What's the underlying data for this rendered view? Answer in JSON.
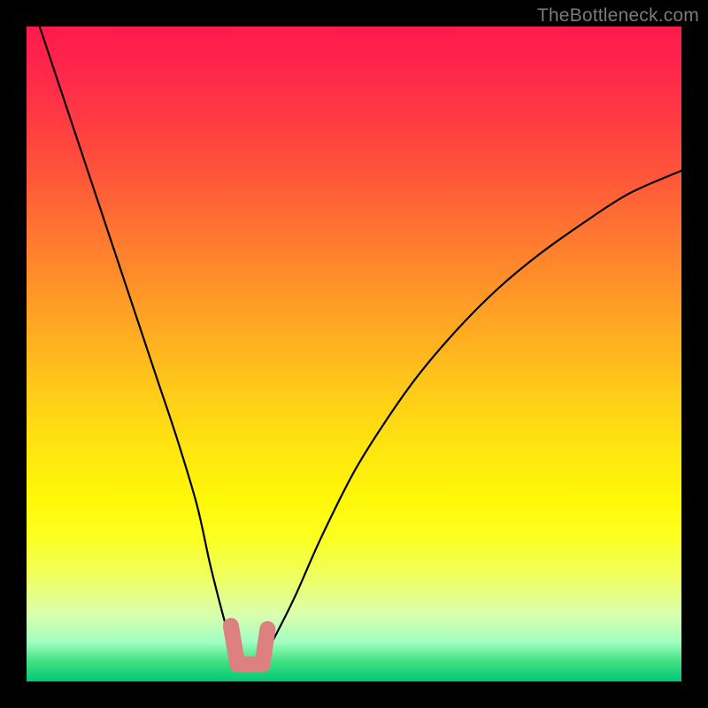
{
  "watermark": "TheBottleneck.com",
  "colors": {
    "page_bg": "#000000",
    "curve": "#000000",
    "marker": "#dd8080",
    "gradient_top": "#ff1a4d",
    "gradient_bottom": "#00c878"
  },
  "chart_data": {
    "type": "line",
    "title": "",
    "xlabel": "",
    "ylabel": "",
    "xlim": [
      0,
      100
    ],
    "ylim": [
      0,
      100
    ],
    "x": [
      2,
      5,
      8,
      11,
      14,
      17,
      20,
      23,
      26,
      28,
      29.5,
      31,
      32,
      33,
      33.8,
      34.6,
      36,
      38,
      41,
      45,
      50,
      55,
      60,
      66,
      72,
      78,
      85,
      92,
      100
    ],
    "values": [
      100,
      91,
      82,
      73,
      64,
      55,
      46,
      37,
      27,
      18,
      12,
      6.5,
      3.5,
      2.2,
      2.0,
      2.2,
      3.5,
      7,
      13,
      22,
      32,
      40,
      47,
      54,
      60,
      65,
      70,
      74.5,
      78
    ],
    "note": "y=0 at bottom (green), y=100 at top (red). Values estimated from pixel positions.",
    "markers": {
      "type": "u-shape",
      "color": "#dd8080",
      "left_top": {
        "x": 31.2,
        "y": 8.5
      },
      "left_bottom": {
        "x": 32.2,
        "y": 2.6
      },
      "right_bottom": {
        "x": 36.0,
        "y": 2.6
      },
      "right_top": {
        "x": 36.8,
        "y": 8.0
      }
    }
  }
}
